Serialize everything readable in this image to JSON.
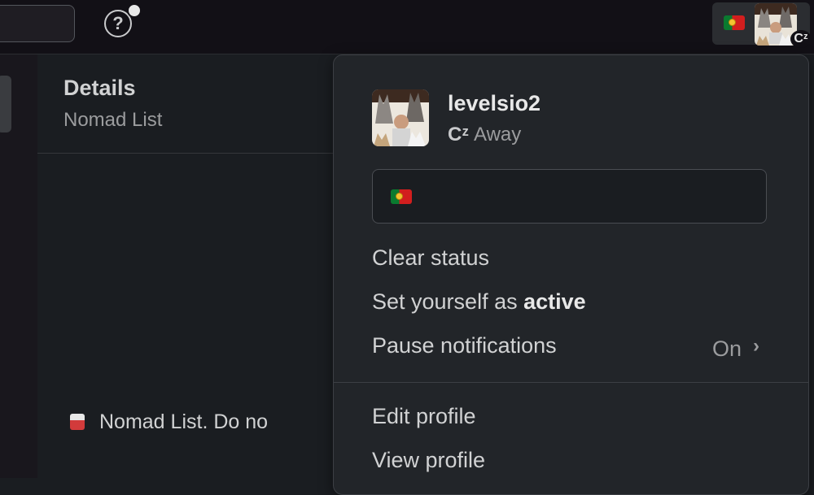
{
  "topbar": {
    "help_icon": "question-circle-icon",
    "help_glyph": "?",
    "away_glyph": "Cᶻ"
  },
  "details": {
    "title": "Details",
    "subtitle": "Nomad List",
    "bottom_text": "Nomad List. Do no"
  },
  "menu": {
    "username": "levelsio2",
    "presence_glyph": "Cᶻ",
    "presence": "Away",
    "status_emoji": "portugal-flag",
    "items": {
      "clear_status": "Clear status",
      "set_active_prefix": "Set yourself as ",
      "set_active_bold": "active",
      "pause_notifications": "Pause notifications",
      "pause_value": "On",
      "edit_profile": "Edit profile",
      "view_profile": "View profile"
    }
  },
  "colors": {
    "background": "#1a1d21",
    "topbar": "#121016",
    "menu": "#222529"
  }
}
